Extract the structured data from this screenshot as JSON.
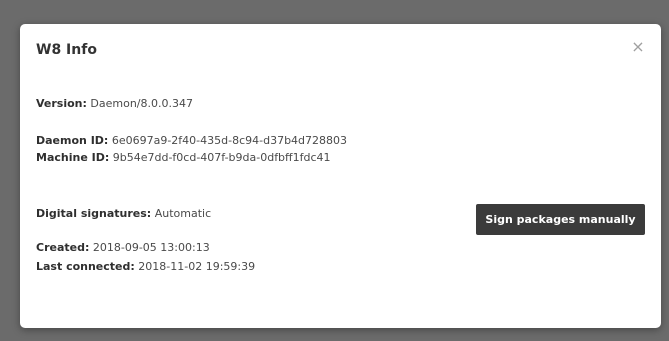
{
  "dialog": {
    "title": "W8 Info",
    "close_glyph": "×",
    "close_icon": "close-icon"
  },
  "info": {
    "version_label": "Version:",
    "version_value": "Daemon/8.0.0.347",
    "daemon_id_label": "Daemon ID:",
    "daemon_id_value": "6e0697a9-2f40-435d-8c94-d37b4d728803",
    "machine_id_label": "Machine ID:",
    "machine_id_value": "9b54e7dd-f0cd-407f-b9da-0dfbff1fdc41",
    "signatures_label": "Digital signatures:",
    "signatures_value": "Automatic",
    "created_label": "Created:",
    "created_value": "2018-09-05 13:00:13",
    "last_connected_label": "Last connected:",
    "last_connected_value": "2018-11-02 19:59:39"
  },
  "actions": {
    "sign_button_label": "Sign packages manually"
  },
  "colors": {
    "backdrop": "#6b6b6b",
    "modal_bg": "#ffffff",
    "button_bg": "#3b3b3b",
    "button_text": "#ffffff"
  }
}
